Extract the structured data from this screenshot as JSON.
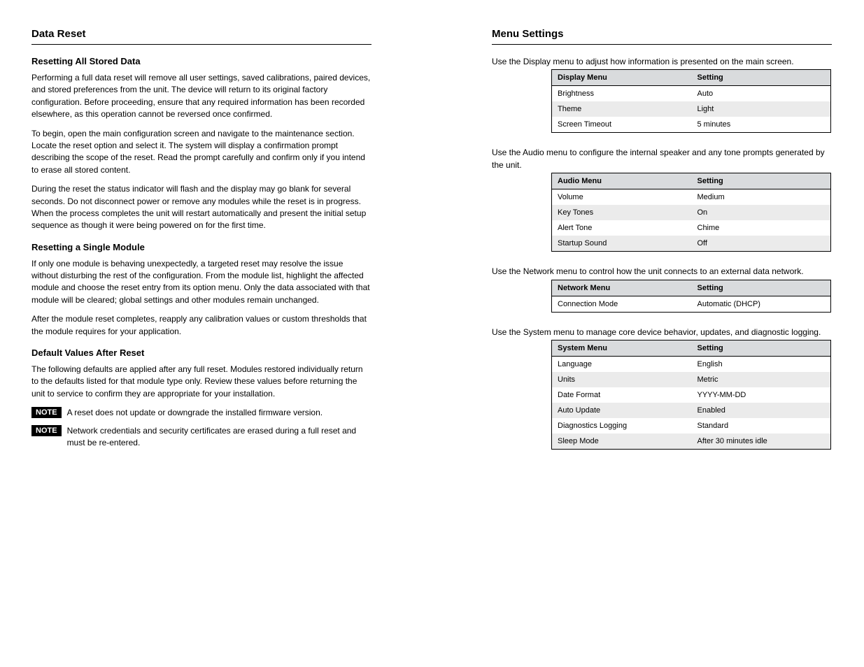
{
  "left": {
    "title": "Data Reset",
    "subhead1": "Resetting All Stored Data",
    "para1": "Performing a full data reset will remove all user settings, saved calibrations, paired devices, and stored preferences from the unit. The device will return to its original factory configuration. Before proceeding, ensure that any required information has been recorded elsewhere, as this operation cannot be reversed once confirmed.",
    "para2": "To begin, open the main configuration screen and navigate to the maintenance section. Locate the reset option and select it. The system will display a confirmation prompt describing the scope of the reset. Read the prompt carefully and confirm only if you intend to erase all stored content.",
    "para3": "During the reset the status indicator will flash and the display may go blank for several seconds. Do not disconnect power or remove any modules while the reset is in progress. When the process completes the unit will restart automatically and present the initial setup sequence as though it were being powered on for the first time.",
    "subhead2": "Resetting a Single Module",
    "para4": "If only one module is behaving unexpectedly, a targeted reset may resolve the issue without disturbing the rest of the configuration. From the module list, highlight the affected module and choose the reset entry from its option menu. Only the data associated with that module will be cleared; global settings and other modules remain unchanged.",
    "para5": "After the module reset completes, reapply any calibration values or custom thresholds that the module requires for your application.",
    "subhead3": "Default Values After Reset",
    "para6": "The following defaults are applied after any full reset. Modules restored individually return to the defaults listed for that module type only. Review these values before returning the unit to service to confirm they are appropriate for your installation.",
    "note_label": "NOTE",
    "note1": "A reset does not update or downgrade the installed firmware version.",
    "note2": "Network credentials and security certificates are erased during a full reset and must be re-entered."
  },
  "right": {
    "title": "Menu Settings",
    "intro_display": "Use the Display menu to adjust how information is presented on the main screen.",
    "intro_audio": "Use the Audio menu to configure the internal speaker and any tone prompts generated by the unit.",
    "intro_network": "Use the Network menu to control how the unit connects to an external data network.",
    "intro_system": "Use the System menu to manage core device behavior, updates, and diagnostic logging.",
    "tables": {
      "display": {
        "header": [
          "Display Menu",
          "Setting"
        ],
        "rows": [
          [
            "Brightness",
            "Auto"
          ],
          [
            "Theme",
            "Light"
          ],
          [
            "Screen Timeout",
            "5 minutes"
          ]
        ]
      },
      "audio": {
        "header": [
          "Audio Menu",
          "Setting"
        ],
        "rows": [
          [
            "Volume",
            "Medium"
          ],
          [
            "Key Tones",
            "On"
          ],
          [
            "Alert Tone",
            "Chime"
          ],
          [
            "Startup Sound",
            "Off"
          ]
        ]
      },
      "network": {
        "header": [
          "Network Menu",
          "Setting"
        ],
        "rows": [
          [
            "Connection Mode",
            "Automatic (DHCP)"
          ]
        ]
      },
      "system": {
        "header": [
          "System Menu",
          "Setting"
        ],
        "rows": [
          [
            "Language",
            "English"
          ],
          [
            "Units",
            "Metric"
          ],
          [
            "Date Format",
            "YYYY-MM-DD"
          ],
          [
            "Auto Update",
            "Enabled"
          ],
          [
            "Diagnostics Logging",
            "Standard"
          ],
          [
            "Sleep Mode",
            "After 30 minutes idle"
          ]
        ]
      }
    }
  }
}
